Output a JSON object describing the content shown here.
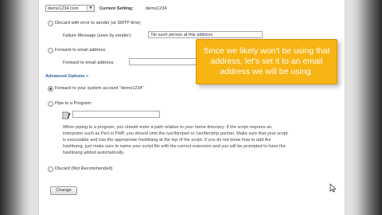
{
  "current": {
    "select_value": "demo1234.com",
    "label": "Current Setting:",
    "value": "demo1234"
  },
  "discard_error": {
    "label": "Discard with error to sender (at SMTP time)",
    "failure_label": "Failure Message (seen by sender):",
    "failure_value": "No such person at this address"
  },
  "forward_email": {
    "label": "Forward to email address",
    "field_label": "Forward to email address:",
    "field_value": ""
  },
  "advanced": {
    "heading": "Advanced Options »",
    "forward_system": "Forward to your system account \"demo1234\"",
    "pipe_label": "Pipe to a Program:",
    "pipe_value": "",
    "pipe_note": "When piping to a program, you should enter a path relative to your home directory. If the script requires an interpreter such as Perl or PHP, you should omit the /usr/bin/perl or /usr/bin/php portion. Make sure that your script is executable and has the appropriate hashbang at the top of the script. If you do not know how to add the hashbang, just make sure to name your script file with the correct extension and you will be prompted to have the hashbang added automatically.",
    "discard_label": "Discard (Not Recommended)"
  },
  "change_button": "Change",
  "callout": {
    "text": "Since we likely won't be using that address, let's set it to an email address we will be using."
  },
  "icons": {
    "dropdown": "chevron-down-icon",
    "script": "script-icon",
    "cursor": "mouse-cursor-icon"
  },
  "colors": {
    "callout": "#f7b413",
    "section_heading": "#2e5e9e"
  }
}
